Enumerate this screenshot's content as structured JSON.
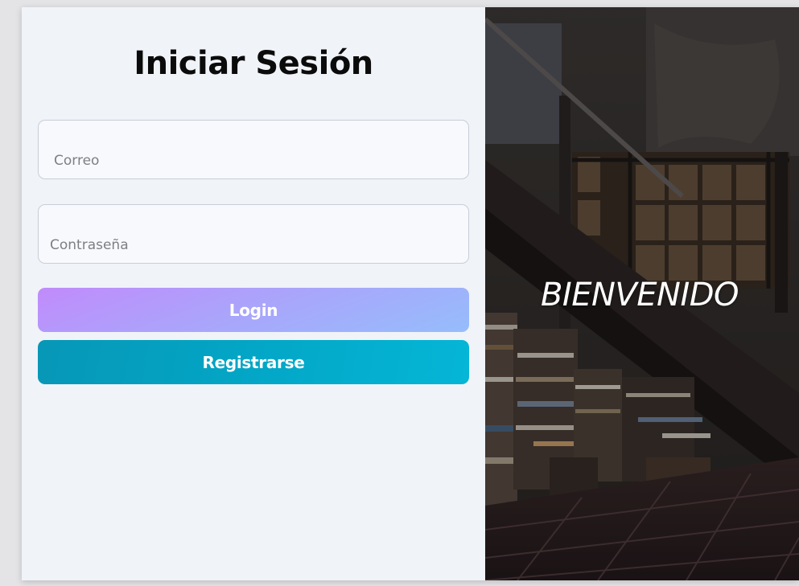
{
  "login": {
    "title": "Iniciar Sesión",
    "email_placeholder": "Correo",
    "password_placeholder": "Contraseña",
    "login_label": "Login",
    "register_label": "Registrarse"
  },
  "hero": {
    "welcome_text": "BIENVENIDO",
    "image_description_icon": "photo-of-library-under-staircase"
  },
  "colors": {
    "form_background": "#f0f3f8",
    "login_gradient_start": "#c18bfb",
    "login_gradient_end": "#95bdfb",
    "register_gradient_start": "#0797b7",
    "register_gradient_end": "#05b6d6",
    "page_background": "#e4e4e6"
  }
}
